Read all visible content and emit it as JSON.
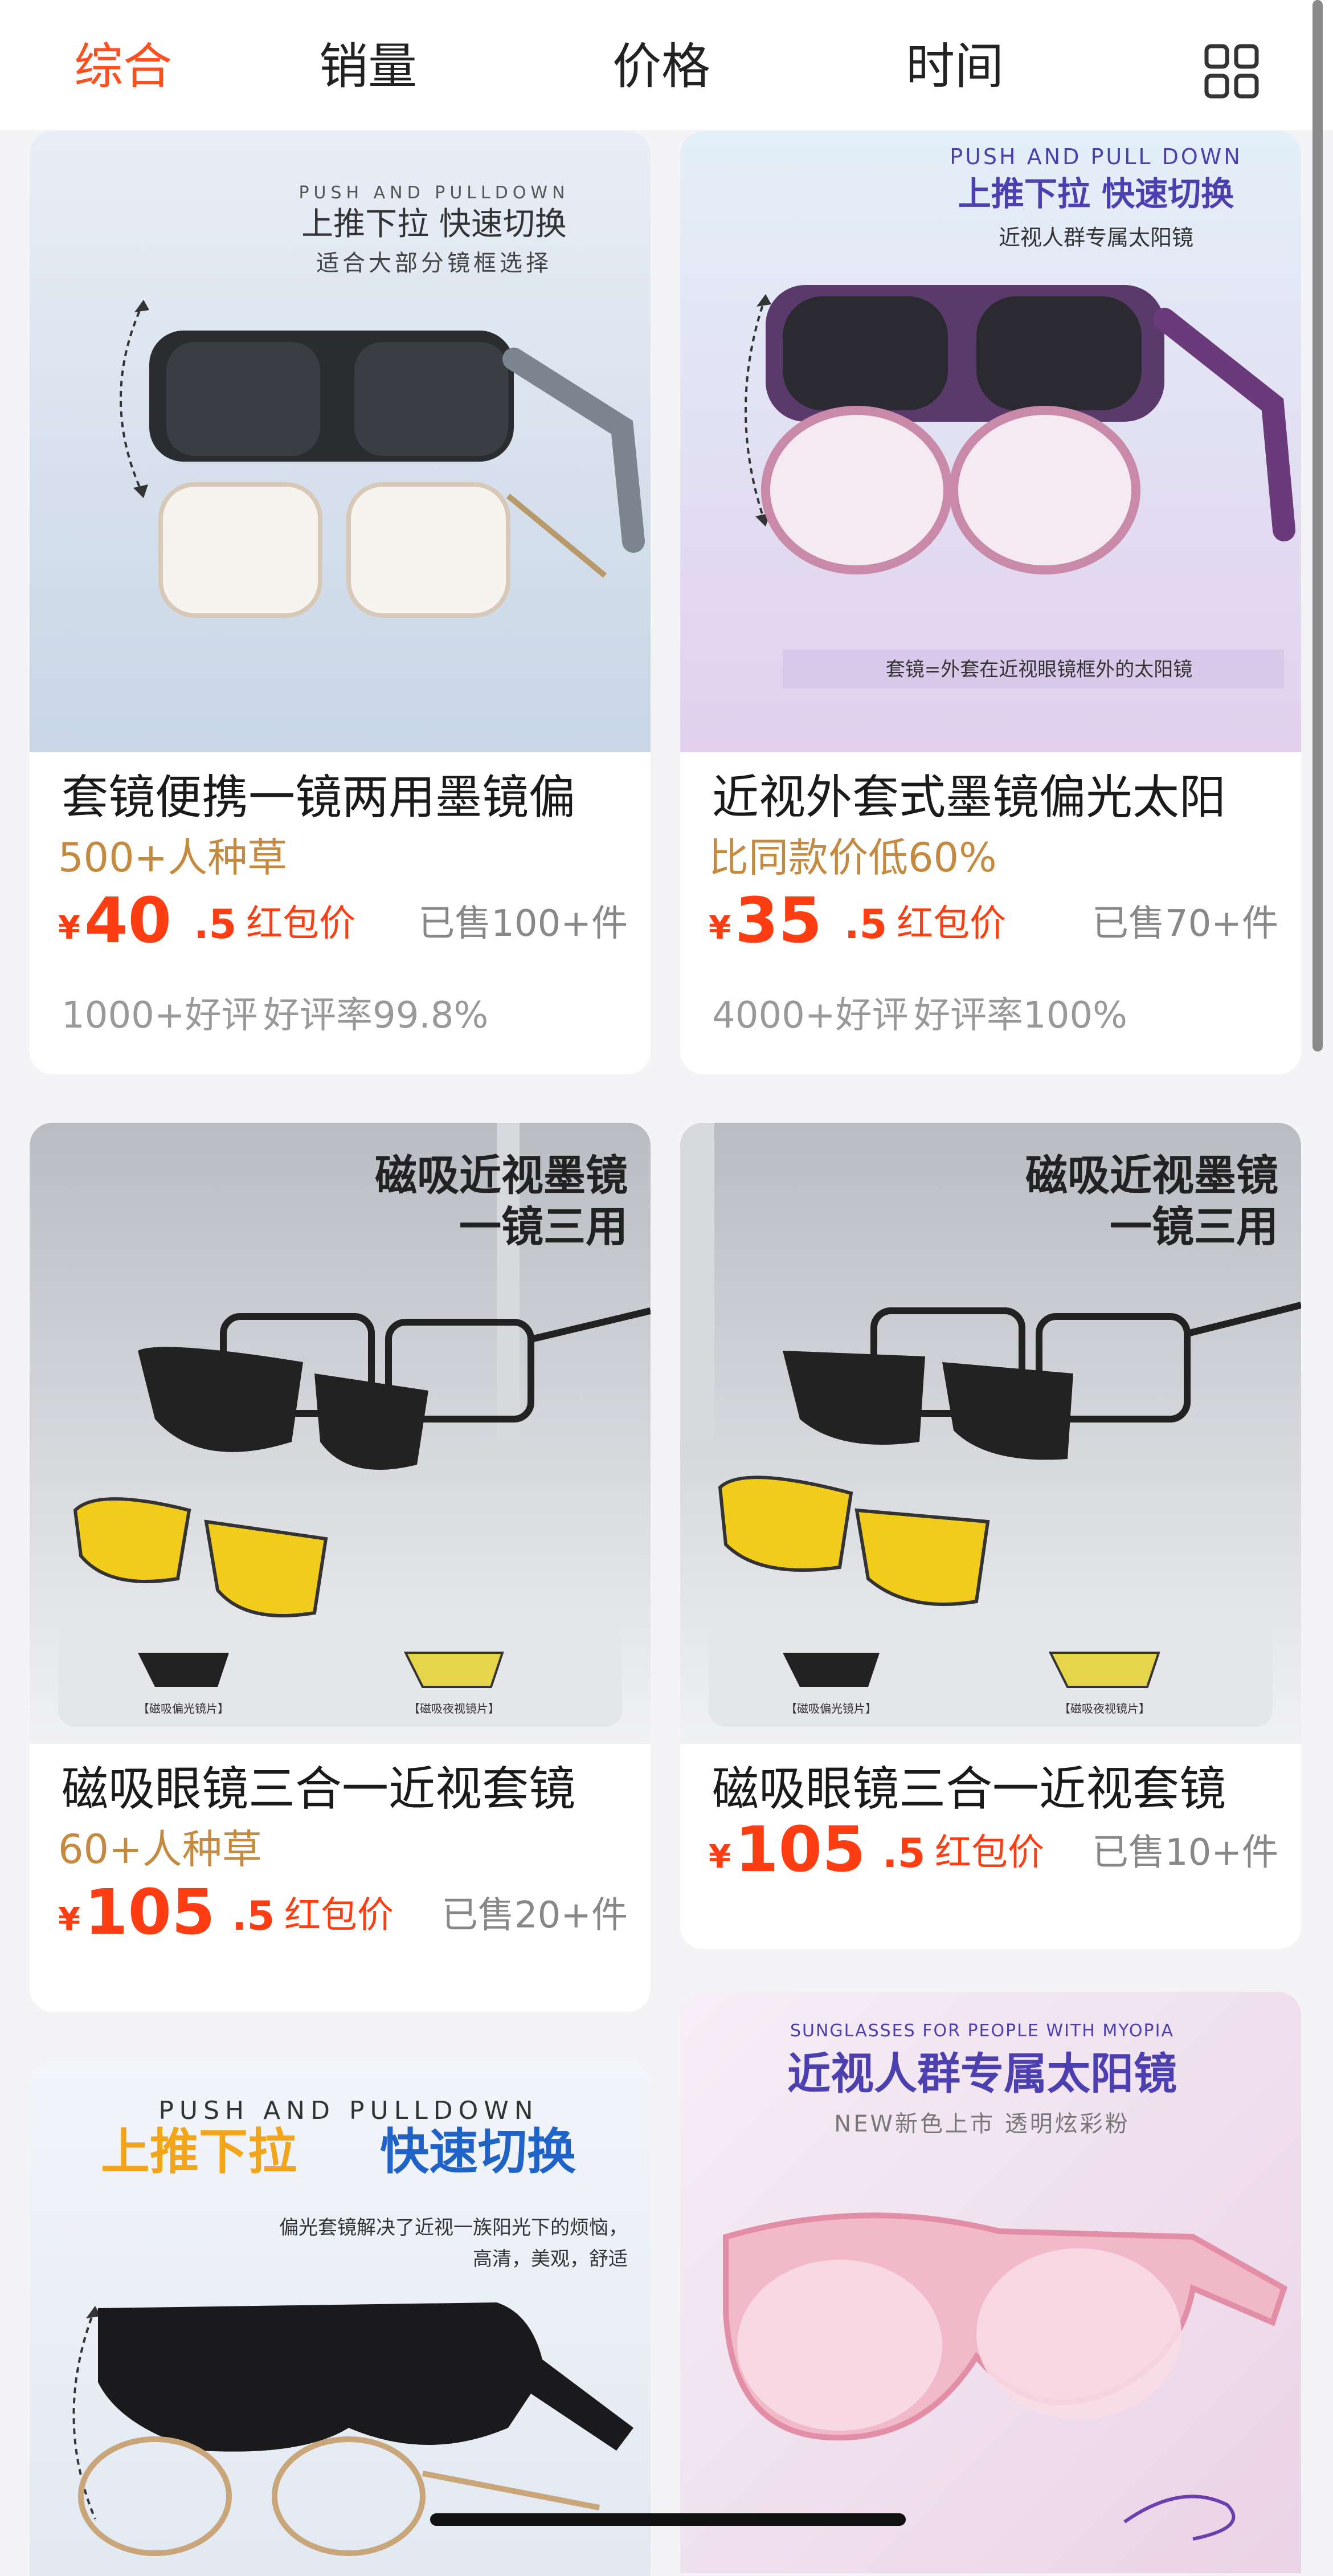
{
  "tabs": [
    {
      "label": "综合",
      "active": true
    },
    {
      "label": "销量",
      "active": false
    },
    {
      "label": "价格",
      "active": false
    },
    {
      "label": "时间",
      "active": false
    }
  ],
  "layout_toggle_icon": "grid-view-icon",
  "colors": {
    "accent": "#ff4f1f",
    "price": "#ff3d12",
    "promo": "#c58a40"
  },
  "products": [
    {
      "title": "套镜便携一镜两用墨镜偏",
      "promo": "500+人种草",
      "price_int": "40",
      "price_dec": ".5",
      "price_label": "红包价",
      "sold": "已售100+件",
      "reviews": "1000+好评",
      "rating": "好评率99.8%",
      "image": {
        "en": "PUSH AND PULLDOWN",
        "headline": "上推下拉  快速切换",
        "sub": "适合大部分镜框选择"
      }
    },
    {
      "title": "近视外套式墨镜偏光太阳",
      "promo": "比同款价低60%",
      "price_int": "35",
      "price_dec": ".5",
      "price_label": "红包价",
      "sold": "已售70+件",
      "reviews": "4000+好评",
      "rating": "好评率100%",
      "image": {
        "en": "PUSH AND PULL DOWN",
        "headline": "上推下拉  快速切换",
        "sub": "近视人群专属太阳镜",
        "caption": "套镜=外套在近视眼镜框外的太阳镜"
      }
    },
    {
      "title": "磁吸眼镜三合一近视套镜",
      "promo": "60+人种草",
      "price_int": "105",
      "price_dec": ".5",
      "price_label": "红包价",
      "sold": "已售20+件",
      "image": {
        "line1": "磁吸近视墨镜",
        "line2": "一镜三用",
        "label1": "【磁吸偏光镜片】",
        "label2": "【磁吸夜视镜片】"
      }
    },
    {
      "title": "磁吸眼镜三合一近视套镜",
      "price_int": "105",
      "price_dec": ".5",
      "price_label": "红包价",
      "sold": "已售10+件",
      "image": {
        "line1": "磁吸近视墨镜",
        "line2": "一镜三用",
        "label1": "【磁吸偏光镜片】",
        "label2": "【磁吸夜视镜片】"
      }
    },
    {
      "image": {
        "en": "PUSH AND PULLDOWN",
        "headline_a": "上推下拉",
        "headline_b": "快速切换",
        "sub1": "偏光套镜解决了近视一族阳光下的烦恼，",
        "sub2": "高清，美观，舒适"
      }
    },
    {
      "image": {
        "en": "SUNGLASSES FOR PEOPLE WITH MYOPIA",
        "headline": "近视人群专属太阳镜",
        "sub": "NEW新色上市  透明炫彩粉"
      }
    }
  ]
}
